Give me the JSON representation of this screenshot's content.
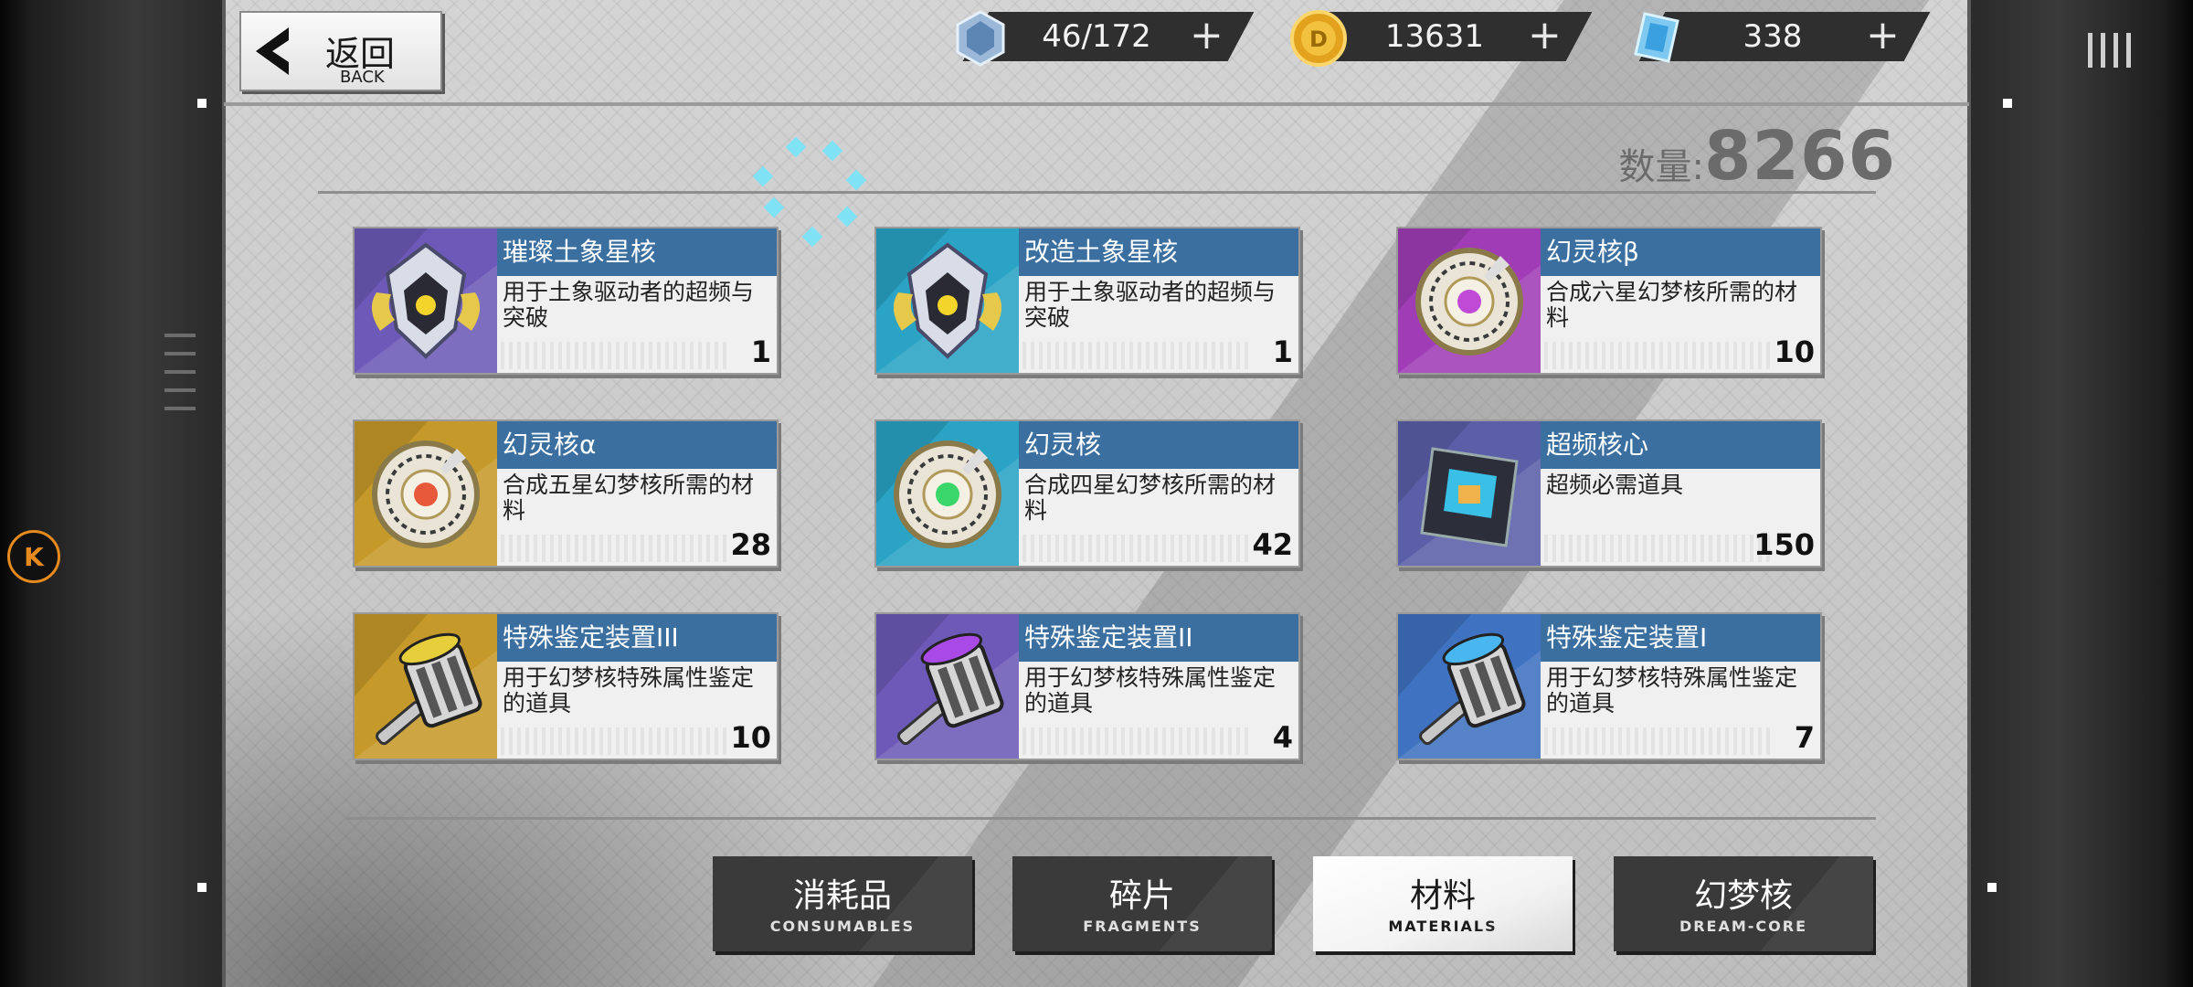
{
  "header": {
    "back_label": "返回",
    "back_sub": "BACK"
  },
  "currencies": [
    {
      "icon": "stamina-crystal-icon",
      "value": "46/172"
    },
    {
      "icon": "gold-coin-icon",
      "value": "13631"
    },
    {
      "icon": "blue-diamond-icon",
      "value": "338"
    }
  ],
  "inventory": {
    "count_label": "数量:",
    "count_value": "8266"
  },
  "items": [
    {
      "name": "璀璨土象星核",
      "desc": "用于土象驱动者的超频与突破",
      "qty": "1",
      "icon": "earth-star-core-icon",
      "bg": "#6d5ab8"
    },
    {
      "name": "改造土象星核",
      "desc": "用于土象驱动者的超频与突破",
      "qty": "1",
      "icon": "earth-star-core-icon",
      "bg": "#2aa3c4"
    },
    {
      "name": "幻灵核β",
      "desc": "合成六星幻梦核所需的材料",
      "qty": "10",
      "icon": "spirit-core-beta-icon",
      "bg": "#a03cb6"
    },
    {
      "name": "幻灵核α",
      "desc": "合成五星幻梦核所需的材料",
      "qty": "28",
      "icon": "spirit-core-alpha-icon",
      "bg": "#c69a2a"
    },
    {
      "name": "幻灵核",
      "desc": "合成四星幻梦核所需的材料",
      "qty": "42",
      "icon": "spirit-core-icon",
      "bg": "#2aa3c4"
    },
    {
      "name": "超频核心",
      "desc": "超频必需道具",
      "qty": "150",
      "icon": "overclock-core-icon",
      "bg": "#5a5fa8"
    },
    {
      "name": "特殊鉴定装置III",
      "desc": "用于幻梦核特殊属性鉴定的道具",
      "qty": "10",
      "icon": "appraisal-hammer-gold-icon",
      "bg": "#c69a2a"
    },
    {
      "name": "特殊鉴定装置II",
      "desc": "用于幻梦核特殊属性鉴定的道具",
      "qty": "4",
      "icon": "appraisal-hammer-purple-icon",
      "bg": "#6d5ab8"
    },
    {
      "name": "特殊鉴定装置I",
      "desc": "用于幻梦核特殊属性鉴定的道具",
      "qty": "7",
      "icon": "appraisal-hammer-blue-icon",
      "bg": "#3f72c0"
    }
  ],
  "tabs": [
    {
      "cn": "消耗品",
      "en": "CONSUMABLES",
      "active": false
    },
    {
      "cn": "碎片",
      "en": "FRAGMENTS",
      "active": false
    },
    {
      "cn": "材料",
      "en": "MATERIALS",
      "active": true
    },
    {
      "cn": "幻梦核",
      "en": "DREAM-CORE",
      "active": false
    }
  ],
  "side": {
    "k_label": "K"
  }
}
